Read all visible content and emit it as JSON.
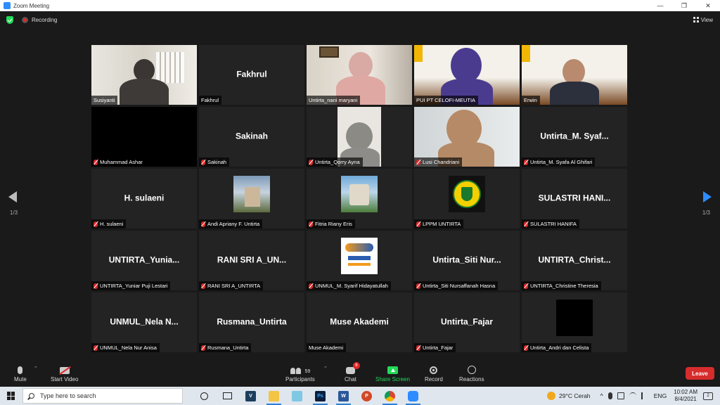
{
  "window": {
    "title": "Zoom Meeting",
    "controls": [
      "—",
      "❐",
      "✕"
    ]
  },
  "meeting_bar": {
    "recording_label": "Recording",
    "view_label": "View"
  },
  "participants": [
    {
      "display": "video",
      "name": "Susiyanti",
      "muted": false,
      "active": true
    },
    {
      "display": "name",
      "big": "Fakhrul",
      "name": "Fakhrul",
      "muted": false
    },
    {
      "display": "video",
      "name": "Untirta_nani maryani",
      "muted": false
    },
    {
      "display": "video",
      "name": "PUI PT CELOFI-MEUTIA",
      "muted": false
    },
    {
      "display": "video",
      "name": "Erwin",
      "muted": false
    },
    {
      "display": "black",
      "name": "Muhammad Ashar",
      "muted": true
    },
    {
      "display": "name",
      "big": "Sakinah",
      "name": "Sakinah",
      "muted": true
    },
    {
      "display": "video",
      "name": "Untirta_Qorry Ayna",
      "muted": true
    },
    {
      "display": "video",
      "name": "Lusi Chandriani",
      "muted": true
    },
    {
      "display": "name",
      "big": "Untirta_M. Syaf...",
      "name": "Untirta_M. Syafa Al Ghifari",
      "muted": true
    },
    {
      "display": "name",
      "big": "H. sulaeni",
      "name": "H. sulaeni",
      "muted": true
    },
    {
      "display": "thumb",
      "name": "Andi Apriany F. Untirta",
      "muted": true
    },
    {
      "display": "thumb",
      "name": "Fitria Riany Eris",
      "muted": true
    },
    {
      "display": "thumb",
      "name": "LPPM UNTIRTA",
      "muted": true
    },
    {
      "display": "name",
      "big": "SULASTRI HANI...",
      "name": "SULASTRI HANIFA",
      "muted": true
    },
    {
      "display": "name",
      "big": "UNTIRTA_Yunia...",
      "name": "UNTIRTA_Yuniar Puji Lestari",
      "muted": true
    },
    {
      "display": "name",
      "big": "RANI SRI A_UN...",
      "name": "RANI SRI A_UNTIRTA",
      "muted": true
    },
    {
      "display": "thumb",
      "name": "UNMUL_M. Syarif Hidayatullah",
      "muted": true
    },
    {
      "display": "name",
      "big": "Untirta_Siti Nur...",
      "name": "Untirta_Siti Nursaffanah Hasna",
      "muted": true
    },
    {
      "display": "name",
      "big": "UNTIRTA_Christ...",
      "name": "UNTIRTA_Christine Theresia",
      "muted": true
    },
    {
      "display": "name",
      "big": "UNMUL_Nela N...",
      "name": "UNMUL_Nela Nur Anisa",
      "muted": true
    },
    {
      "display": "name",
      "big": "Rusmana_Untirta",
      "name": "Rusmana_Untirta",
      "muted": true
    },
    {
      "display": "name",
      "big": "Muse Akademi",
      "name": "Muse Akademi",
      "muted": false
    },
    {
      "display": "name",
      "big": "Untirta_Fajar",
      "name": "Untirta_Fajar",
      "muted": true
    },
    {
      "display": "thumb",
      "name": "Untirta_Andri dan Celista",
      "muted": true
    }
  ],
  "pagination": {
    "left": "1/3",
    "right": "1/3"
  },
  "toolbar": {
    "mute": "Mute",
    "video": "Start Video",
    "participants": "Participants",
    "participants_count": "59",
    "chat": "Chat",
    "chat_badge": "6",
    "share": "Share Screen",
    "record": "Record",
    "reactions": "Reactions",
    "leave": "Leave"
  },
  "taskbar": {
    "search_placeholder": "Type here to search",
    "weather": "29°C  Cerah",
    "lang": "ENG",
    "time": "10:02 AM",
    "date": "8/4/2021",
    "notif_count": "2"
  }
}
